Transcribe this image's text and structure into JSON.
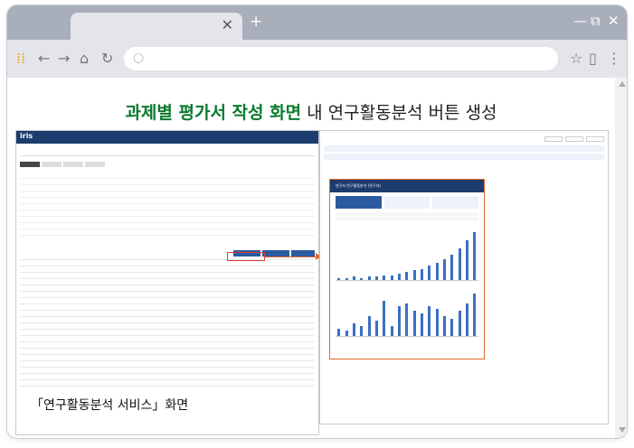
{
  "browser": {
    "close_glyph": "✕",
    "newtab_glyph": "+",
    "minimize_glyph": "—",
    "restore_glyph": "⧉",
    "winclose_glyph": "✕",
    "icons": [
      "apps-icon",
      "back-icon",
      "forward-icon",
      "home-icon",
      "reload-icon",
      "search-icon",
      "star-icon",
      "page-icon",
      "menu-icon"
    ]
  },
  "content": {
    "heading_bold": "과제별 평가서 작성 화면",
    "heading_rest": " 내 연구활동분석 버튼 생성",
    "caption": "「연구활동분석 서비스」화면",
    "iris_logo": "iris",
    "popup_title": "연구자 연구활동분석 (연구자)"
  },
  "chart_data": [
    {
      "type": "bar",
      "values": [
        1,
        1,
        2,
        1,
        2,
        2,
        3,
        3,
        4,
        5,
        6,
        7,
        9,
        11,
        13,
        16,
        20,
        25,
        30
      ]
    },
    {
      "type": "bar",
      "values": [
        3,
        2,
        5,
        4,
        8,
        6,
        14,
        4,
        12,
        13,
        10,
        9,
        12,
        11,
        8,
        7,
        10,
        13,
        17
      ]
    }
  ]
}
